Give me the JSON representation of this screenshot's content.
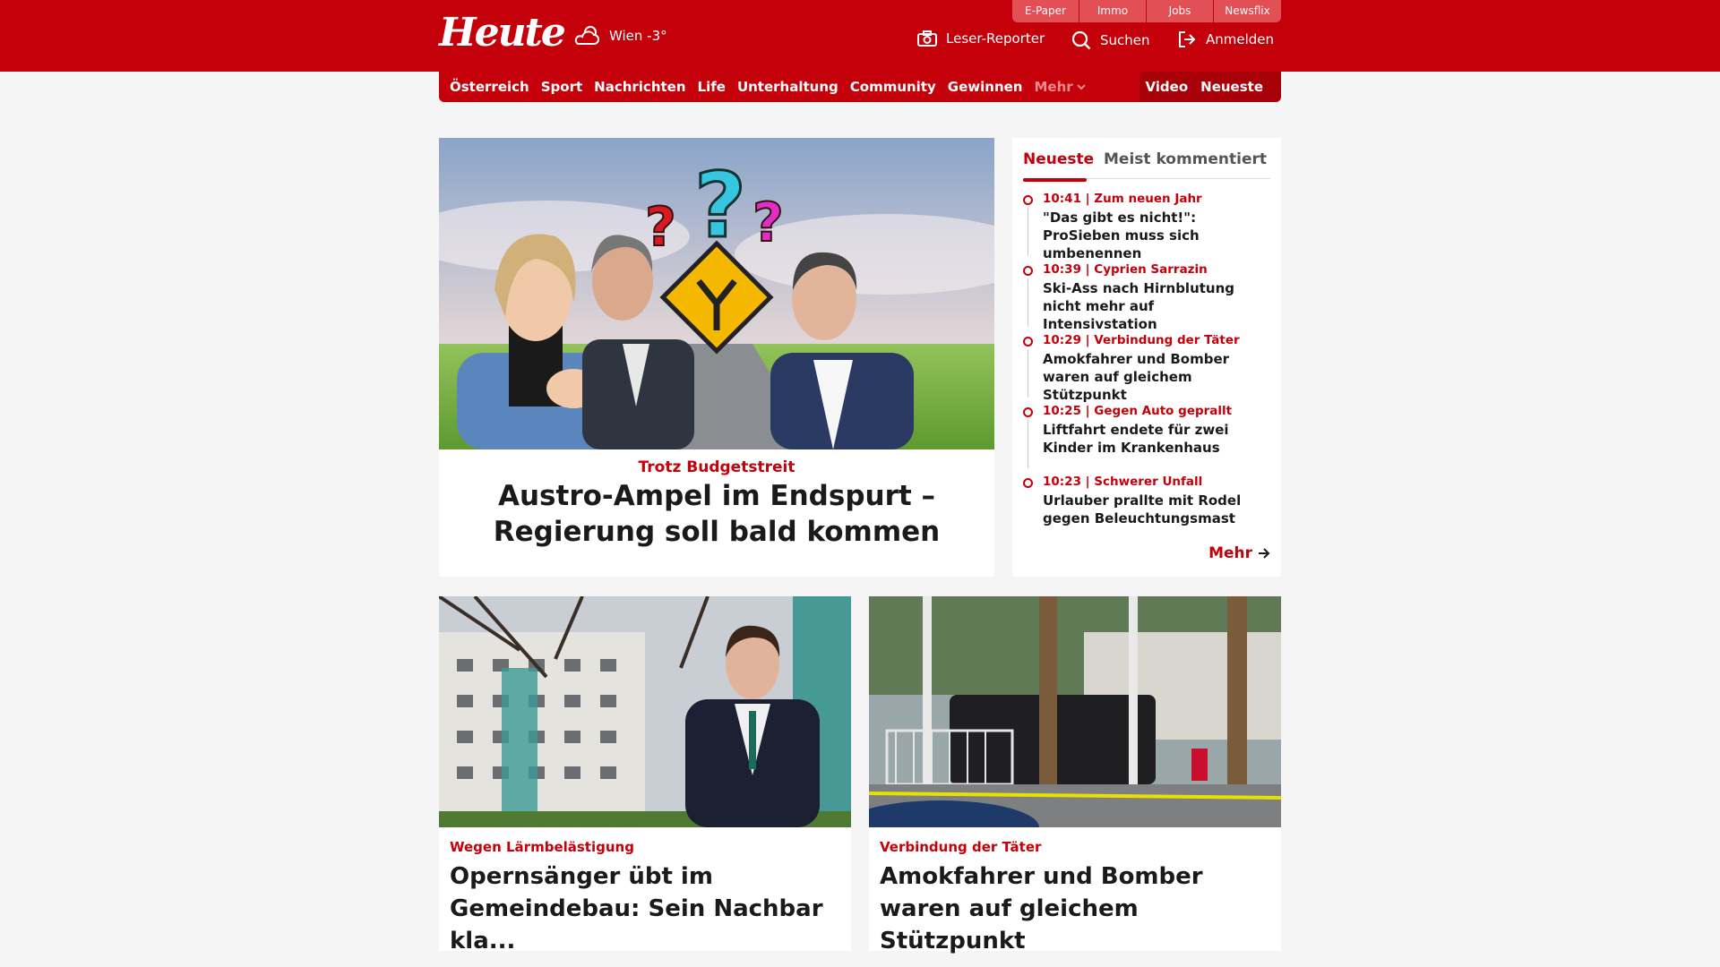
{
  "header": {
    "logo": "Heute",
    "weather": "Wien -3°",
    "util_tabs": [
      "E-Paper",
      "Immo",
      "Jobs",
      "Newsflix"
    ],
    "actions": {
      "reporter": "Leser-Reporter",
      "search": "Suchen",
      "login": "Anmelden"
    }
  },
  "nav": {
    "items": [
      "Österreich",
      "Sport",
      "Nachrichten",
      "Life",
      "Unterhaltung",
      "Community",
      "Gewinnen"
    ],
    "more": "Mehr",
    "right": [
      "Video",
      "Neueste"
    ]
  },
  "hero": {
    "kicker": "Trotz Budgetstreit",
    "title": "Austro-Ampel im Endspurt – Regierung soll bald kommen"
  },
  "sidebar": {
    "tabs": {
      "active": "Neueste",
      "inactive": "Meist kommentiert"
    },
    "items": [
      {
        "meta": "10:41 | Zum neuen Jahr",
        "headline": "\"Das gibt es nicht!\": ProSieben muss sich umbenennen"
      },
      {
        "meta": "10:39 | Cyprien Sarrazin",
        "headline": "Ski-Ass nach Hirnblutung nicht mehr auf Intensivstation"
      },
      {
        "meta": "10:29 | Verbindung der Täter",
        "headline": "Amokfahrer und Bomber waren auf gleichem Stützpunkt"
      },
      {
        "meta": "10:25 | Gegen Auto geprallt",
        "headline": "Liftfahrt endete für zwei Kinder im Krankenhaus"
      },
      {
        "meta": "10:23 | Schwerer Unfall",
        "headline": "Urlauber prallte mit Rodel gegen Beleuchtungsmast"
      }
    ],
    "more": "Mehr"
  },
  "cards": [
    {
      "kicker": "Wegen Lärmbelästigung",
      "title": "Opernsänger übt im Gemeindebau: Sein Nachbar kla..."
    },
    {
      "kicker": "Verbindung der Täter",
      "title": "Amokfahrer und Bomber waren auf gleichem Stützpunkt"
    }
  ],
  "colors": {
    "brand": "#c4000a",
    "brand_dark": "#a80008",
    "tab": "#e25056",
    "background": "#f5f5f5"
  }
}
